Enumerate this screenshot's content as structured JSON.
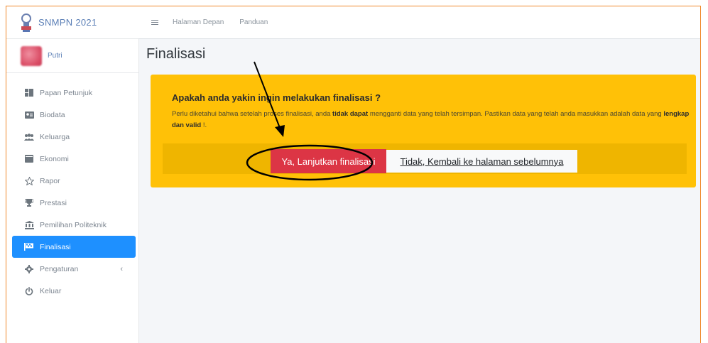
{
  "brand": {
    "title": "SNMPN 2021",
    "logo_icon": "snmpn-logo-icon"
  },
  "user": {
    "name": "Putri"
  },
  "sidebar": {
    "items": [
      {
        "label": "Papan Petunjuk",
        "icon": "dashboard-icon"
      },
      {
        "label": "Biodata",
        "icon": "id-card-icon"
      },
      {
        "label": "Keluarga",
        "icon": "users-icon"
      },
      {
        "label": "Ekonomi",
        "icon": "wallet-icon"
      },
      {
        "label": "Rapor",
        "icon": "star-icon"
      },
      {
        "label": "Prestasi",
        "icon": "trophy-icon"
      },
      {
        "label": "Pemilihan Politeknik",
        "icon": "institution-icon"
      },
      {
        "label": "Finalisasi",
        "icon": "flag-icon",
        "active": true
      },
      {
        "label": "Pengaturan",
        "icon": "cog-icon",
        "caret": "‹"
      },
      {
        "label": "Keluar",
        "icon": "power-icon"
      }
    ]
  },
  "topbar": {
    "links": [
      "Halaman Depan",
      "Panduan"
    ]
  },
  "page": {
    "title": "Finalisasi"
  },
  "alert": {
    "heading": "Apakah anda yakin ingin melakukan finalisasi ?",
    "text_1": "Perlu diketahui bahwa setelah proses finalisasi, anda ",
    "text_bold_1": "tidak dapat",
    "text_2": " mengganti data yang telah tersimpan. Pastikan data yang telah anda masukkan adalah data yang ",
    "text_bold_2": "lengkap dan valid",
    "text_3": " !.",
    "confirm_label": "Ya, Lanjutkan finalisasi",
    "cancel_label": "Tidak, Kembali ke halaman sebelumnya"
  },
  "colors": {
    "accent": "#1e90ff",
    "warning": "#ffc107",
    "danger": "#dc3545",
    "annotation": "#000000",
    "frame_border": "#f08a2c"
  }
}
